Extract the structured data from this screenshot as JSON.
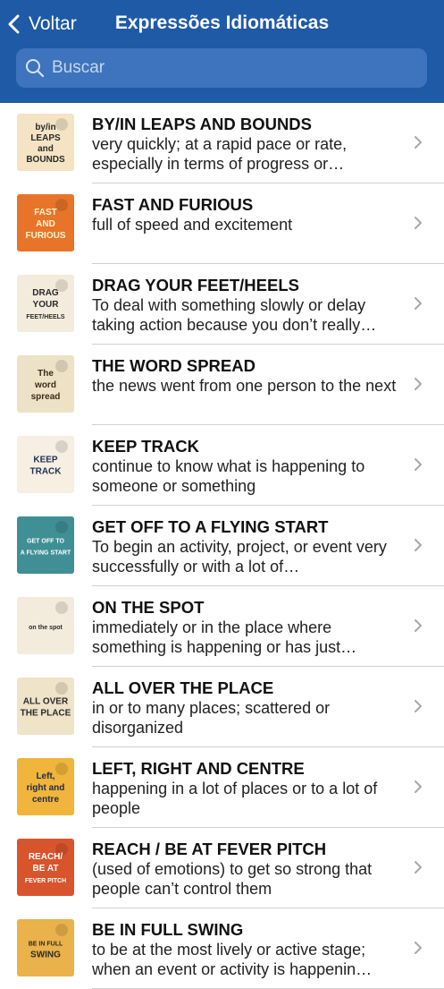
{
  "header": {
    "back_label": "Voltar",
    "title": "Expressões Idiomáticas",
    "search_placeholder": "Buscar",
    "color": "#1f5aa6"
  },
  "items": [
    {
      "term": "BY/IN LEAPS AND BOUNDS",
      "definition": "very quickly; at a rapid pace or rate, especially in terms of progress or…",
      "thumb_text": [
        "by/in",
        "LEAPS",
        "and",
        "BOUNDS"
      ],
      "thumb_bg": "#f4e4c4",
      "thumb_fg": "#2a2a2a"
    },
    {
      "term": "FAST AND FURIOUS",
      "definition": "full of speed and excitement",
      "thumb_text": [
        "FAST",
        "AND",
        "FURIOUS"
      ],
      "thumb_bg": "#e8742a",
      "thumb_fg": "#fff6d0"
    },
    {
      "term": "DRAG YOUR FEET/HEELS",
      "definition": "To deal with something slowly or delay taking action because you don’t really…",
      "thumb_text": [
        "DRAG",
        "YOUR",
        "FEET/HEELS"
      ],
      "thumb_bg": "#f3ebdc",
      "thumb_fg": "#2a2a2a"
    },
    {
      "term": "THE WORD SPREAD",
      "definition": "the news went from one person to the next",
      "thumb_text": [
        "The",
        "word",
        "spread"
      ],
      "thumb_bg": "#eee2c6",
      "thumb_fg": "#3a2a1a"
    },
    {
      "term": "KEEP TRACK",
      "definition": "continue to know what is happening to someone or something",
      "thumb_text": [
        "KEEP",
        "TRACK"
      ],
      "thumb_bg": "#f6efe2",
      "thumb_fg": "#1f2f55"
    },
    {
      "term": "GET OFF TO A FLYING START",
      "definition": "To begin an activity, project, or event very successfully or with a lot of…",
      "thumb_text": [
        "GET OFF TO",
        "A FLYING START"
      ],
      "thumb_bg": "#3f8f95",
      "thumb_fg": "#ffffff"
    },
    {
      "term": "ON THE SPOT",
      "definition": "immediately or in the place where something is happening or has just…",
      "thumb_text": [
        "on the spot"
      ],
      "thumb_bg": "#f3ebdc",
      "thumb_fg": "#2a2a2a"
    },
    {
      "term": "ALL OVER THE PLACE",
      "definition": "in or to many places; scattered or disorganized",
      "thumb_text": [
        "ALL OVER",
        "THE PLACE"
      ],
      "thumb_bg": "#efe3c8",
      "thumb_fg": "#2a2a2a"
    },
    {
      "term": "LEFT, RIGHT AND CENTRE",
      "definition": "happening in a lot of places or to a lot of people",
      "thumb_text": [
        "Left,",
        "right and",
        "centre"
      ],
      "thumb_bg": "#f0b53a",
      "thumb_fg": "#1e2a4a"
    },
    {
      "term": "REACH / BE AT FEVER PITCH",
      "definition": "(used of emotions) to get so strong that people can’t control them",
      "thumb_text": [
        "REACH/",
        "BE AT",
        "FEVER PITCH"
      ],
      "thumb_bg": "#d8542c",
      "thumb_fg": "#ffffff"
    },
    {
      "term": "BE IN FULL SWING",
      "definition": "to be at the most lively or active stage; when an event or activity is happenin…",
      "thumb_text": [
        "BE IN FULL",
        "SWING"
      ],
      "thumb_bg": "#eab24a",
      "thumb_fg": "#2a2a2a"
    }
  ]
}
